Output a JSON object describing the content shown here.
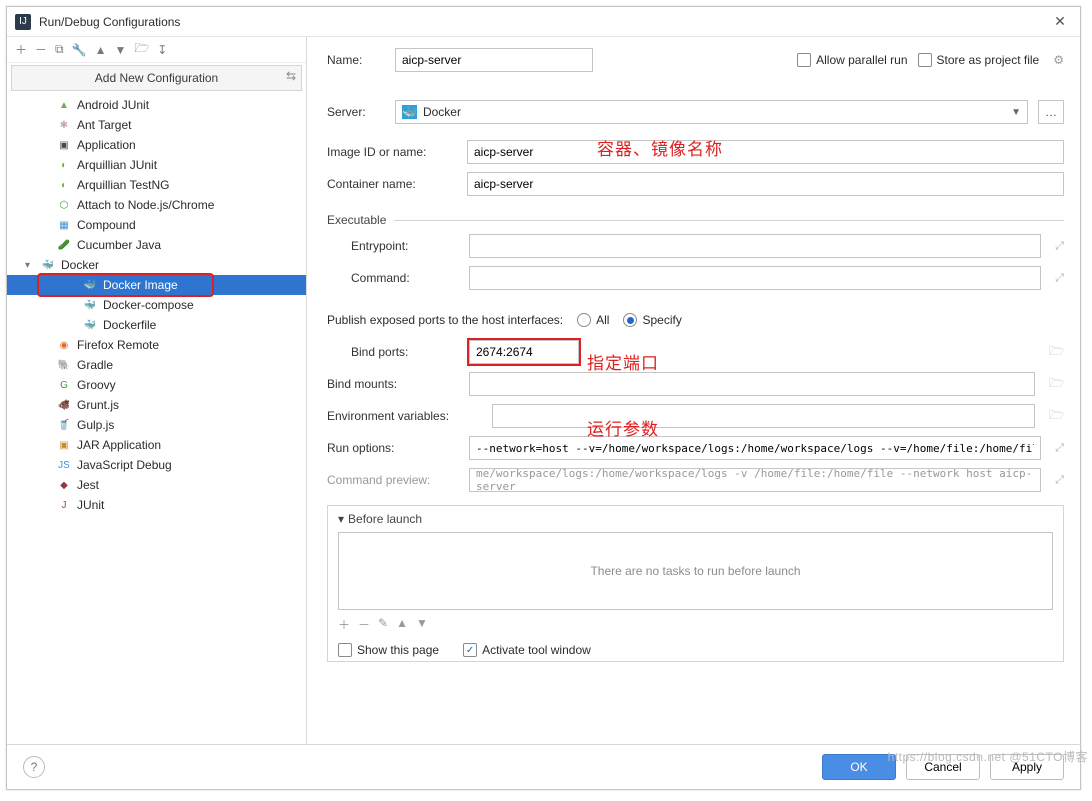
{
  "window": {
    "title": "Run/Debug Configurations"
  },
  "sidebar": {
    "header": "Add New Configuration",
    "items": [
      {
        "label": "Android JUnit",
        "color": "#6ab04c",
        "glyph": "▲"
      },
      {
        "label": "Ant Target",
        "color": "#c9a8a8",
        "glyph": "✱"
      },
      {
        "label": "Application",
        "color": "#4a4a4a",
        "glyph": "▣"
      },
      {
        "label": "Arquillian JUnit",
        "color": "#6bbf2a",
        "glyph": "◐"
      },
      {
        "label": "Arquillian TestNG",
        "color": "#6bbf2a",
        "glyph": "◐"
      },
      {
        "label": "Attach to Node.js/Chrome",
        "color": "#3c9f3c",
        "glyph": "⬡"
      },
      {
        "label": "Compound",
        "color": "#3e8fd6",
        "glyph": "▦"
      },
      {
        "label": "Cucumber Java",
        "color": "#3e8fd6",
        "glyph": "🥒"
      },
      {
        "label": "Docker",
        "color": "#2e9fd8",
        "glyph": "🐳",
        "expandable": true
      }
    ],
    "docker_children": [
      {
        "label": "Docker Image"
      },
      {
        "label": "Docker-compose"
      },
      {
        "label": "Dockerfile"
      }
    ],
    "items_after": [
      {
        "label": "Firefox Remote",
        "color": "#e06a2b",
        "glyph": "◉"
      },
      {
        "label": "Gradle",
        "color": "#3a7a5a",
        "glyph": "🐘"
      },
      {
        "label": "Groovy",
        "color": "#3a9a3a",
        "glyph": "G"
      },
      {
        "label": "Grunt.js",
        "color": "#b5651d",
        "glyph": "🐗"
      },
      {
        "label": "Gulp.js",
        "color": "#d04545",
        "glyph": "🥤"
      },
      {
        "label": "JAR Application",
        "color": "#d0892a",
        "glyph": "▣"
      },
      {
        "label": "JavaScript Debug",
        "color": "#3e8fd6",
        "glyph": "JS"
      },
      {
        "label": "Jest",
        "color": "#8a3a3a",
        "glyph": "◆"
      },
      {
        "label": "JUnit",
        "color": "#b03a3a",
        "glyph": "J"
      }
    ]
  },
  "form": {
    "name_label": "Name:",
    "name_value": "aicp-server",
    "allow_parallel_label": "Allow parallel run",
    "store_label": "Store as project file",
    "server_label": "Server:",
    "server_value": "Docker",
    "image_label": "Image ID or name:",
    "image_value": "aicp-server",
    "container_label": "Container name:",
    "container_value": "aicp-server",
    "executable_label": "Executable",
    "entrypoint_label": "Entrypoint:",
    "entrypoint_value": "",
    "command_label": "Command:",
    "command_value": "",
    "publish_label": "Publish exposed ports to the host interfaces:",
    "publish_all": "All",
    "publish_specify": "Specify",
    "bind_ports_label": "Bind ports:",
    "bind_ports_value": "2674:2674",
    "bind_mounts_label": "Bind mounts:",
    "bind_mounts_value": "",
    "env_label": "Environment variables:",
    "env_value": "",
    "run_opts_label": "Run options:",
    "run_opts_value": "--network=host --v=/home/workspace/logs:/home/workspace/logs --v=/home/file:/home/file",
    "cmd_preview_label": "Command preview:",
    "cmd_preview_value": "me/workspace/logs:/home/workspace/logs -v /home/file:/home/file --network host aicp-server",
    "before_launch_label": "Before launch",
    "no_tasks": "There are no tasks to run before launch",
    "show_page_label": "Show this page",
    "activate_label": "Activate tool window"
  },
  "annotations": {
    "image_note": "容器、镜像名称",
    "port_note": "指定端口",
    "env_note": "运行参数"
  },
  "footer": {
    "ok": "OK",
    "cancel": "Cancel",
    "apply": "Apply"
  },
  "watermark": "https://blog.csdn.net @51CTO博客"
}
